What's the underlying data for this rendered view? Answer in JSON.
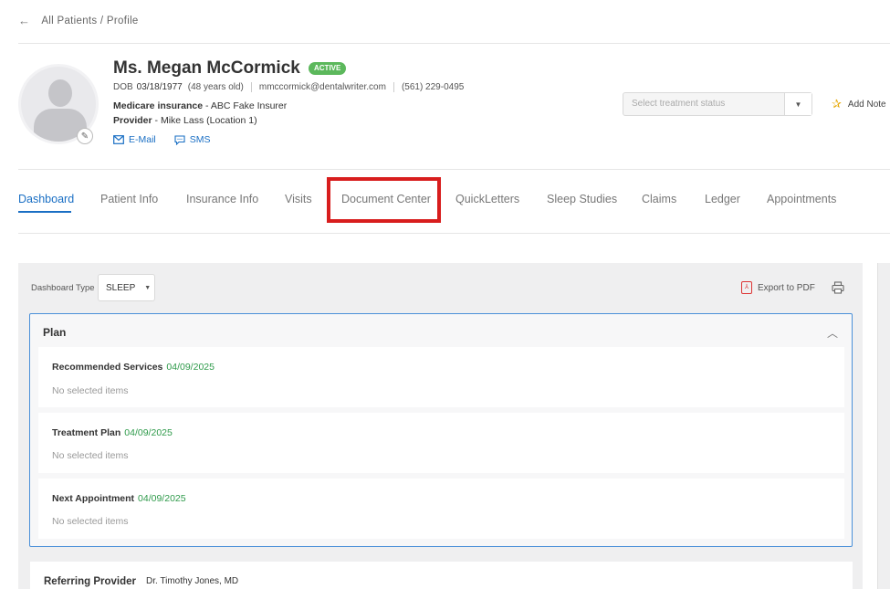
{
  "breadcrumb": {
    "back": "←",
    "text": "All Patients / Profile"
  },
  "patient": {
    "name": "Ms. Megan McCormick",
    "status_badge": "ACTIVE",
    "dob_label": "DOB",
    "dob": "03/18/1977",
    "age": "(48 years old)",
    "email": "mmccormick@dentalwriter.com",
    "phone": "(561) 229-0495",
    "insurance_label": "Medicare insurance",
    "insurance_value": "ABC Fake Insurer",
    "provider_label": "Provider",
    "provider_value": "Mike Lass (Location 1)",
    "email_action": "E-Mail",
    "sms_action": "SMS"
  },
  "treatment_status": {
    "placeholder": "Select treatment status"
  },
  "add_note": "Add Note",
  "tabs": [
    {
      "label": "Dashboard",
      "active": true
    },
    {
      "label": "Patient Info"
    },
    {
      "label": "Insurance Info"
    },
    {
      "label": "Visits"
    },
    {
      "label": "Document Center",
      "highlighted": true
    },
    {
      "label": "QuickLetters"
    },
    {
      "label": "Sleep Studies"
    },
    {
      "label": "Claims"
    },
    {
      "label": "Ledger"
    },
    {
      "label": "Appointments"
    }
  ],
  "dashboard": {
    "type_label": "Dashboard Type",
    "type_value": "SLEEP",
    "export_label": "Export to PDF",
    "plan": {
      "title": "Plan",
      "cards": [
        {
          "title": "Recommended Services",
          "date": "04/09/2025",
          "empty": "No selected items"
        },
        {
          "title": "Treatment Plan",
          "date": "04/09/2025",
          "empty": "No selected items"
        },
        {
          "title": "Next Appointment",
          "date": "04/09/2025",
          "empty": "No selected items"
        }
      ]
    },
    "referring_provider": {
      "label": "Referring Provider",
      "value": "Dr. Timothy Jones, MD"
    }
  },
  "colors": {
    "accent": "#1a6fc4",
    "active_badge": "#5cb85c",
    "date_green": "#2e9a4a",
    "highlight_red": "#d81d1d"
  }
}
